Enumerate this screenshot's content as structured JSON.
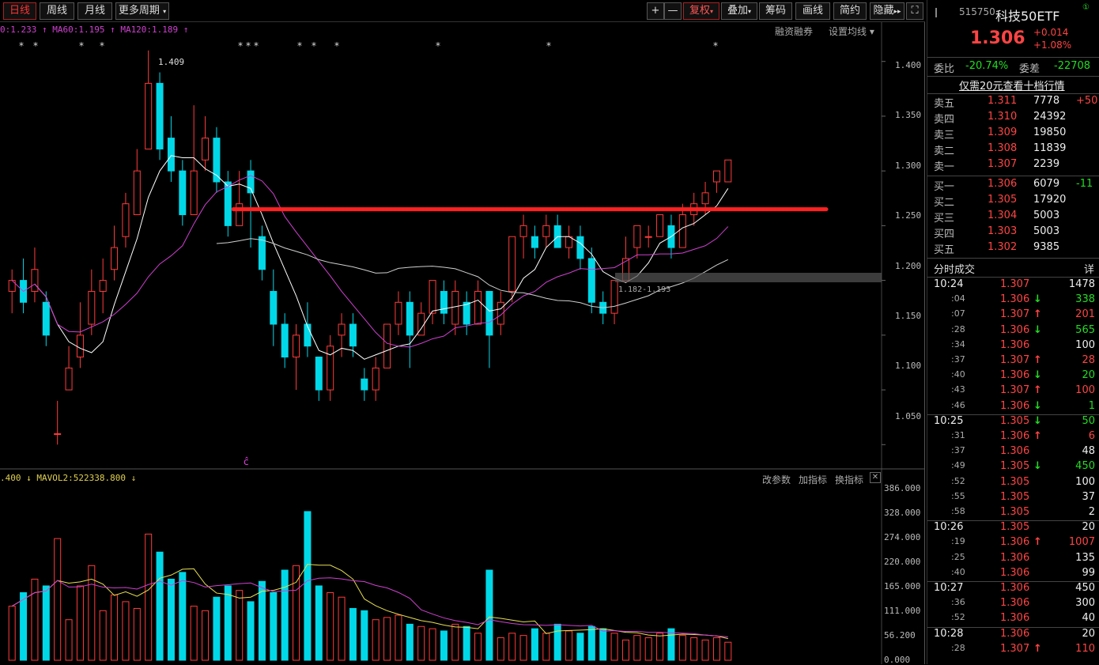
{
  "toolbar": {
    "period_tabs": [
      "日线",
      "周线",
      "月线",
      "更多周期"
    ],
    "tools": [
      "+",
      "—",
      "复权",
      "叠加",
      "筹码",
      "画线",
      "简约",
      "隐藏"
    ]
  },
  "indicator_bar": {
    "ma_text": "0:1.233 ↑ MA60:1.195 ↑ MA120:1.189 ↑",
    "right_menu": [
      "融资融券",
      "设置均线"
    ]
  },
  "price_axis": [
    "1.400",
    "1.350",
    "1.300",
    "1.250",
    "1.200",
    "1.150",
    "1.100",
    "1.050"
  ],
  "volume_axis": [
    "386.000",
    "328.000",
    "274.000",
    "220.000",
    "165.000",
    "111.000",
    "56.200",
    "0.000"
  ],
  "annotations": {
    "high": "1.409",
    "range": "1.182-1.193",
    "marker": "ĉ"
  },
  "volume_bar": {
    "text": ".400 ↓ MAVOL2:522338.800 ↓",
    "menu": [
      "改参数",
      "加指标",
      "换指标"
    ]
  },
  "quote": {
    "code": "515750",
    "name": "科技50ETF",
    "price": "1.306",
    "change": "+0.014",
    "pct": "+1.08%",
    "weibi_label": "委比",
    "weibi": "-20.74%",
    "weicha_label": "委差",
    "weicha": "-22708",
    "promo": "仅需20元查看十档行情",
    "sells": [
      {
        "label": "卖五",
        "price": "1.311",
        "vol": "7778",
        "chg": "+50"
      },
      {
        "label": "卖四",
        "price": "1.310",
        "vol": "24392",
        "chg": ""
      },
      {
        "label": "卖三",
        "price": "1.309",
        "vol": "19850",
        "chg": ""
      },
      {
        "label": "卖二",
        "price": "1.308",
        "vol": "11839",
        "chg": ""
      },
      {
        "label": "卖一",
        "price": "1.307",
        "vol": "2239",
        "chg": ""
      }
    ],
    "buys": [
      {
        "label": "买一",
        "price": "1.306",
        "vol": "6079",
        "chg": "-11"
      },
      {
        "label": "买二",
        "price": "1.305",
        "vol": "17920",
        "chg": ""
      },
      {
        "label": "买三",
        "price": "1.304",
        "vol": "5003",
        "chg": ""
      },
      {
        "label": "买四",
        "price": "1.303",
        "vol": "5003",
        "chg": ""
      },
      {
        "label": "买五",
        "price": "1.302",
        "vol": "9385",
        "chg": ""
      }
    ],
    "ticks_title": "分时成交",
    "ticks_detail": "详",
    "ticks": [
      {
        "t": "10:24",
        "p": "1.307",
        "a": "",
        "v": "1478",
        "big": true
      },
      {
        "t": ":04",
        "p": "1.306",
        "a": "↓",
        "v": "338"
      },
      {
        "t": ":07",
        "p": "1.307",
        "a": "↑",
        "v": "201"
      },
      {
        "t": ":28",
        "p": "1.306",
        "a": "↓",
        "v": "565"
      },
      {
        "t": ":34",
        "p": "1.306",
        "a": "",
        "v": "100"
      },
      {
        "t": ":37",
        "p": "1.307",
        "a": "↑",
        "v": "28"
      },
      {
        "t": ":40",
        "p": "1.306",
        "a": "↓",
        "v": "20"
      },
      {
        "t": ":43",
        "p": "1.307",
        "a": "↑",
        "v": "100"
      },
      {
        "t": ":46",
        "p": "1.306",
        "a": "↓",
        "v": "1"
      },
      {
        "t": "10:25",
        "p": "1.305",
        "a": "↓",
        "v": "50",
        "big": true
      },
      {
        "t": ":31",
        "p": "1.306",
        "a": "↑",
        "v": "6"
      },
      {
        "t": ":37",
        "p": "1.306",
        "a": "",
        "v": "48"
      },
      {
        "t": ":49",
        "p": "1.305",
        "a": "↓",
        "v": "450"
      },
      {
        "t": ":52",
        "p": "1.305",
        "a": "",
        "v": "100"
      },
      {
        "t": ":55",
        "p": "1.305",
        "a": "",
        "v": "37"
      },
      {
        "t": ":58",
        "p": "1.305",
        "a": "",
        "v": "2"
      },
      {
        "t": "10:26",
        "p": "1.305",
        "a": "",
        "v": "20",
        "big": true
      },
      {
        "t": ":19",
        "p": "1.306",
        "a": "↑",
        "v": "1007"
      },
      {
        "t": ":25",
        "p": "1.306",
        "a": "",
        "v": "135"
      },
      {
        "t": ":40",
        "p": "1.306",
        "a": "",
        "v": "99"
      },
      {
        "t": "10:27",
        "p": "1.306",
        "a": "",
        "v": "450",
        "big": true
      },
      {
        "t": ":36",
        "p": "1.306",
        "a": "",
        "v": "300"
      },
      {
        "t": ":52",
        "p": "1.306",
        "a": "",
        "v": "40"
      },
      {
        "t": "10:28",
        "p": "1.306",
        "a": "",
        "v": "20",
        "big": true
      },
      {
        "t": ":28",
        "p": "1.307",
        "a": "↑",
        "v": "110"
      }
    ]
  },
  "colors": {
    "up": "#ff3b3b",
    "down": "#00d8e8",
    "ma1": "#ffffff",
    "ma60": "#d040d0",
    "ma120": "#cfcfcf",
    "vol_ma": "#e8e050",
    "resistance": "#ff2020"
  },
  "chart_data": {
    "type": "candlestick",
    "ylim": [
      1.03,
      1.42
    ],
    "candles": [
      [
        1.19,
        1.2,
        1.17,
        1.16,
        1.21
      ],
      [
        1.2,
        1.18,
        1.17,
        1.21,
        1.22
      ],
      [
        1.19,
        1.21,
        1.18,
        1.22,
        1.23
      ],
      [
        1.18,
        1.15,
        1.14,
        1.19,
        1.19
      ],
      [
        1.06,
        1.06,
        1.05,
        1.1,
        1.09
      ],
      [
        1.1,
        1.12,
        1.1,
        1.11,
        1.14
      ],
      [
        1.13,
        1.15,
        1.12,
        1.16,
        1.18
      ],
      [
        1.16,
        1.19,
        1.15,
        1.2,
        1.21
      ],
      [
        1.19,
        1.2,
        1.17,
        1.21,
        1.22
      ],
      [
        1.21,
        1.23,
        1.2,
        1.24,
        1.25
      ],
      [
        1.24,
        1.27,
        1.23,
        1.28,
        1.28
      ],
      [
        1.26,
        1.3,
        1.26,
        1.31,
        1.32
      ],
      [
        1.32,
        1.38,
        1.32,
        1.4,
        1.41
      ],
      [
        1.38,
        1.32,
        1.31,
        1.39,
        1.39
      ],
      [
        1.33,
        1.3,
        1.29,
        1.34,
        1.35
      ],
      [
        1.3,
        1.26,
        1.25,
        1.31,
        1.31
      ],
      [
        1.26,
        1.3,
        1.26,
        1.31,
        1.36
      ],
      [
        1.31,
        1.33,
        1.3,
        1.34,
        1.35
      ],
      [
        1.33,
        1.29,
        1.28,
        1.33,
        1.34
      ],
      [
        1.29,
        1.25,
        1.24,
        1.3,
        1.3
      ],
      [
        1.25,
        1.27,
        1.25,
        1.3,
        1.3
      ],
      [
        1.3,
        1.28,
        1.23,
        1.31,
        1.31
      ],
      [
        1.24,
        1.21,
        1.2,
        1.25,
        1.25
      ],
      [
        1.19,
        1.16,
        1.14,
        1.2,
        1.21
      ],
      [
        1.16,
        1.13,
        1.12,
        1.17,
        1.17
      ],
      [
        1.13,
        1.15,
        1.1,
        1.16,
        1.16
      ],
      [
        1.16,
        1.14,
        1.13,
        1.18,
        1.18
      ],
      [
        1.13,
        1.1,
        1.09,
        1.13,
        1.13
      ],
      [
        1.1,
        1.14,
        1.09,
        1.15,
        1.15
      ],
      [
        1.15,
        1.16,
        1.13,
        1.17,
        1.17
      ],
      [
        1.16,
        1.14,
        1.13,
        1.17,
        1.17
      ],
      [
        1.11,
        1.1,
        1.09,
        1.12,
        1.12
      ],
      [
        1.1,
        1.12,
        1.09,
        1.13,
        1.13
      ],
      [
        1.12,
        1.16,
        1.12,
        1.16,
        1.16
      ],
      [
        1.16,
        1.18,
        1.15,
        1.19,
        1.19
      ],
      [
        1.18,
        1.15,
        1.12,
        1.19,
        1.19
      ],
      [
        1.15,
        1.17,
        1.15,
        1.18,
        1.18
      ],
      [
        1.17,
        1.2,
        1.16,
        1.2,
        1.2
      ],
      [
        1.19,
        1.17,
        1.16,
        1.2,
        1.2
      ],
      [
        1.16,
        1.19,
        1.15,
        1.2,
        1.2
      ],
      [
        1.18,
        1.16,
        1.15,
        1.19,
        1.19
      ],
      [
        1.16,
        1.19,
        1.16,
        1.2,
        1.2
      ],
      [
        1.19,
        1.15,
        1.12,
        1.19,
        1.19
      ],
      [
        1.16,
        1.18,
        1.15,
        1.19,
        1.19
      ],
      [
        1.19,
        1.24,
        1.18,
        1.24,
        1.24
      ],
      [
        1.24,
        1.25,
        1.22,
        1.26,
        1.26
      ],
      [
        1.24,
        1.23,
        1.22,
        1.25,
        1.25
      ],
      [
        1.24,
        1.25,
        1.23,
        1.26,
        1.26
      ],
      [
        1.25,
        1.23,
        1.23,
        1.26,
        1.26
      ],
      [
        1.23,
        1.24,
        1.22,
        1.25,
        1.25
      ],
      [
        1.24,
        1.22,
        1.21,
        1.25,
        1.25
      ],
      [
        1.22,
        1.18,
        1.17,
        1.23,
        1.23
      ],
      [
        1.18,
        1.17,
        1.16,
        1.19,
        1.19
      ],
      [
        1.17,
        1.2,
        1.16,
        1.2,
        1.2
      ],
      [
        1.2,
        1.22,
        1.2,
        1.24,
        1.24
      ],
      [
        1.23,
        1.25,
        1.22,
        1.25,
        1.25
      ],
      [
        1.24,
        1.24,
        1.23,
        1.25,
        1.25
      ],
      [
        1.24,
        1.26,
        1.24,
        1.26,
        1.26
      ],
      [
        1.25,
        1.23,
        1.22,
        1.26,
        1.26
      ],
      [
        1.23,
        1.26,
        1.23,
        1.27,
        1.27
      ],
      [
        1.26,
        1.27,
        1.25,
        1.28,
        1.28
      ],
      [
        1.27,
        1.28,
        1.26,
        1.29,
        1.29
      ],
      [
        1.29,
        1.3,
        1.28,
        1.3,
        1.3
      ],
      [
        1.29,
        1.31,
        1.29,
        1.31,
        1.31
      ]
    ],
    "volumes": [
      120,
      150,
      180,
      165,
      270,
      90,
      165,
      210,
      110,
      145,
      130,
      115,
      280,
      240,
      180,
      195,
      120,
      110,
      140,
      165,
      155,
      130,
      175,
      150,
      200,
      210,
      330,
      165,
      150,
      140,
      115,
      110,
      90,
      95,
      100,
      80,
      75,
      70,
      65,
      80,
      75,
      60,
      200,
      50,
      60,
      55,
      70,
      60,
      80,
      65,
      60,
      75,
      70,
      60,
      45,
      55,
      50,
      60,
      70,
      55,
      50,
      45,
      50,
      40
    ]
  }
}
